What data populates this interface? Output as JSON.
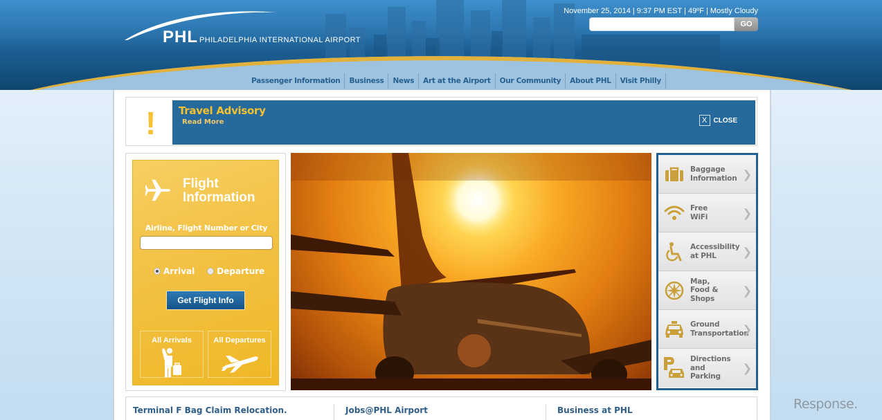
{
  "header": {
    "logo_abbr": "PHL",
    "logo_full": "PHILADELPHIA INTERNATIONAL AIRPORT",
    "weather_line": "November 25, 2014 | 9:37 PM EST | 49ºF | Mostly Cloudy",
    "search": {
      "value": "",
      "placeholder": "",
      "go_label": "GO"
    }
  },
  "nav": {
    "items": [
      {
        "label": "Passenger Information"
      },
      {
        "label": "Business"
      },
      {
        "label": "News"
      },
      {
        "label": "Art at the Airport"
      },
      {
        "label": "Our Community"
      },
      {
        "label": "About PHL"
      },
      {
        "label": "Visit Philly"
      }
    ]
  },
  "advisory": {
    "icon": "exclamation-icon",
    "icon_glyph": "!",
    "title": "Travel Advisory",
    "read_more": "Read More",
    "close_glyph": "X",
    "close_label": "CLOSE"
  },
  "flight_info": {
    "title_line1": "Flight",
    "title_line2": "Information",
    "search_label": "Airline, Flight Number or City",
    "search_value": "",
    "radio_options": [
      {
        "label": "Arrival",
        "selected": true
      },
      {
        "label": "Departure",
        "selected": false
      }
    ],
    "submit_label": "Get Flight Info",
    "all_arrivals_label": "All Arrivals",
    "all_departures_label": "All Departures"
  },
  "hero": {
    "description": "Airplane silhouetted against the setting sun on the tarmac"
  },
  "quick_links": [
    {
      "icon": "baggage-icon",
      "label_lines": [
        "Baggage",
        "Information"
      ]
    },
    {
      "icon": "wifi-icon",
      "label_lines": [
        "Free",
        "WiFi"
      ]
    },
    {
      "icon": "accessibility-icon",
      "label_lines": [
        "Accessibility",
        "at PHL"
      ]
    },
    {
      "icon": "compass-map-icon",
      "label_lines": [
        "Map,",
        "Food &",
        "Shops"
      ]
    },
    {
      "icon": "taxi-icon",
      "label_lines": [
        "Ground",
        "Transportation"
      ]
    },
    {
      "icon": "parking-icon",
      "label_lines": [
        "Directions",
        "and",
        "Parking"
      ]
    }
  ],
  "quick_link_arrow": "❯",
  "bottom_links": [
    {
      "label": "Terminal F Bag Claim Relocation."
    },
    {
      "label": "Jobs@PHL Airport"
    },
    {
      "label": "Business at PHL"
    }
  ],
  "watermark": "Response.",
  "colors": {
    "header_blue": "#1c5f94",
    "gold_accent": "#e2b13c",
    "advisory_blue": "#26699c",
    "advisory_yellow": "#f6c12e",
    "flight_panel_yellow": "#f3c246",
    "button_blue": "#1f6aa3",
    "nav_text": "#28618f",
    "quick_icon_gold": "#c9a03a"
  }
}
